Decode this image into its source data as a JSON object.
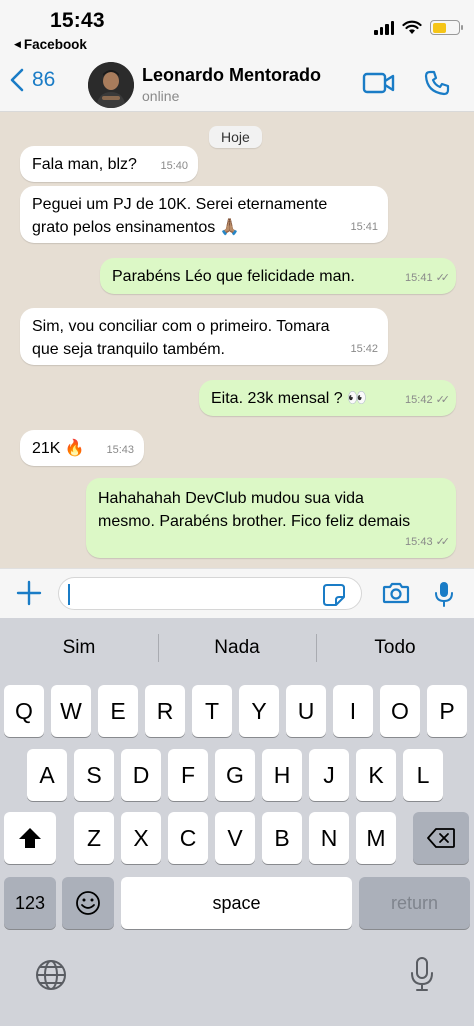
{
  "status_bar": {
    "time": "15:43",
    "back_app": "Facebook"
  },
  "header": {
    "back_count": "86",
    "contact_name": "Leonardo Mentorado",
    "contact_status": "online"
  },
  "chat": {
    "date_label": "Hoje",
    "messages": [
      {
        "direction": "in",
        "text": "Fala man, blz?",
        "time": "15:40"
      },
      {
        "direction": "in",
        "line1": "Peguei um PJ de 10K. Serei eternamente",
        "line2": "grato pelos ensinamentos 🙏🏽",
        "time": "15:41"
      },
      {
        "direction": "out",
        "text": "Parabéns Léo que felicidade man.",
        "time": "15:41",
        "read": true
      },
      {
        "direction": "in",
        "line1": "Sim, vou conciliar com o primeiro. Tomara",
        "line2": "que seja tranquilo também.",
        "time": "15:42"
      },
      {
        "direction": "out",
        "text": "Eita. 23k mensal ? 👀",
        "time": "15:42",
        "read": true
      },
      {
        "direction": "in",
        "text": "21K 🔥",
        "time": "15:43"
      },
      {
        "direction": "out",
        "line1": "Hahahahah DevClub mudou sua vida",
        "line2": "mesmo. Parabéns brother. Fico feliz demais",
        "time": "15:43",
        "read": true
      }
    ]
  },
  "input": {
    "value": "",
    "placeholder": ""
  },
  "keyboard": {
    "suggestions": [
      "Sim",
      "Nada",
      "Todo"
    ],
    "row1": [
      "Q",
      "W",
      "E",
      "R",
      "T",
      "Y",
      "U",
      "I",
      "O",
      "P"
    ],
    "row2": [
      "A",
      "S",
      "D",
      "F",
      "G",
      "H",
      "J",
      "K",
      "L"
    ],
    "row3": [
      "Z",
      "X",
      "C",
      "V",
      "B",
      "N",
      "M"
    ],
    "numbers_label": "123",
    "space_label": "space",
    "return_label": "return"
  },
  "colors": {
    "accent": "#1a7cc6",
    "outgoing_bubble": "#dcf8c6",
    "incoming_bubble": "#ffffff",
    "chat_background": "#e6ded3"
  }
}
